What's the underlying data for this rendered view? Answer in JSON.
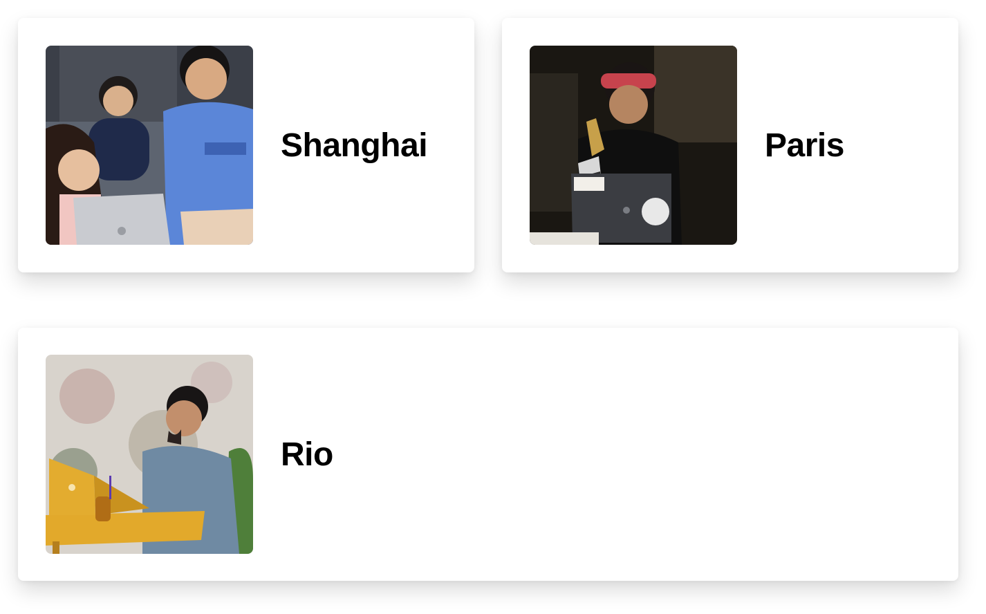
{
  "cities": [
    {
      "name": "Shanghai",
      "photo_icon": "team-coding-photo"
    },
    {
      "name": "Paris",
      "photo_icon": "developer-laptop-photo"
    },
    {
      "name": "Rio",
      "photo_icon": "outdoor-laptop-photo"
    }
  ],
  "colors": {
    "card_background": "#ffffff",
    "text": "#000000"
  }
}
